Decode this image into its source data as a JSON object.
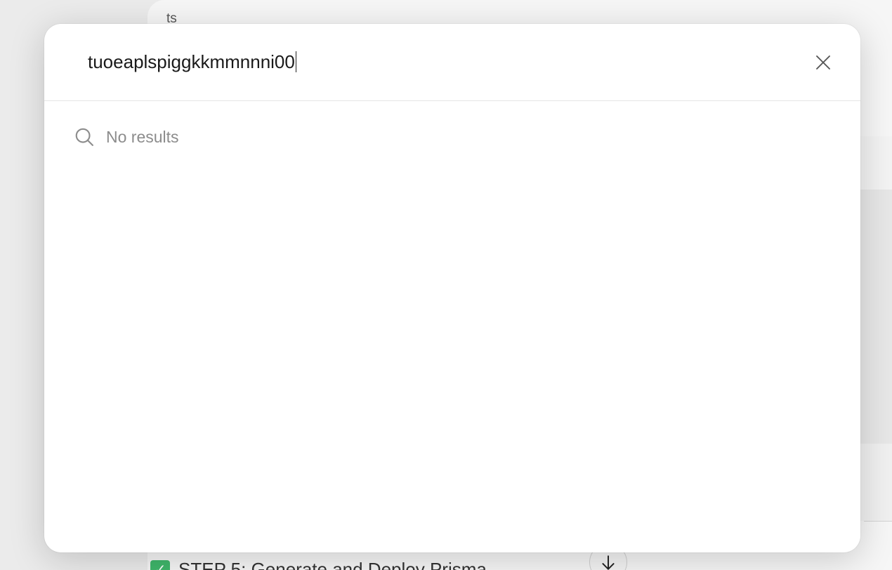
{
  "background": {
    "top_label": "ts",
    "step_check_glyph": "✓",
    "step_label": "STEP 5: Generate and Deploy Prisma",
    "scroll_icon": "arrow-down-icon"
  },
  "search_modal": {
    "query": "tuoeaplspiggkkmmnnni00",
    "close_icon": "close-icon",
    "search_icon": "search-icon",
    "empty_state": "No results"
  },
  "colors": {
    "step_check": "#3fb76b",
    "muted_text": "#8c8c8c"
  }
}
